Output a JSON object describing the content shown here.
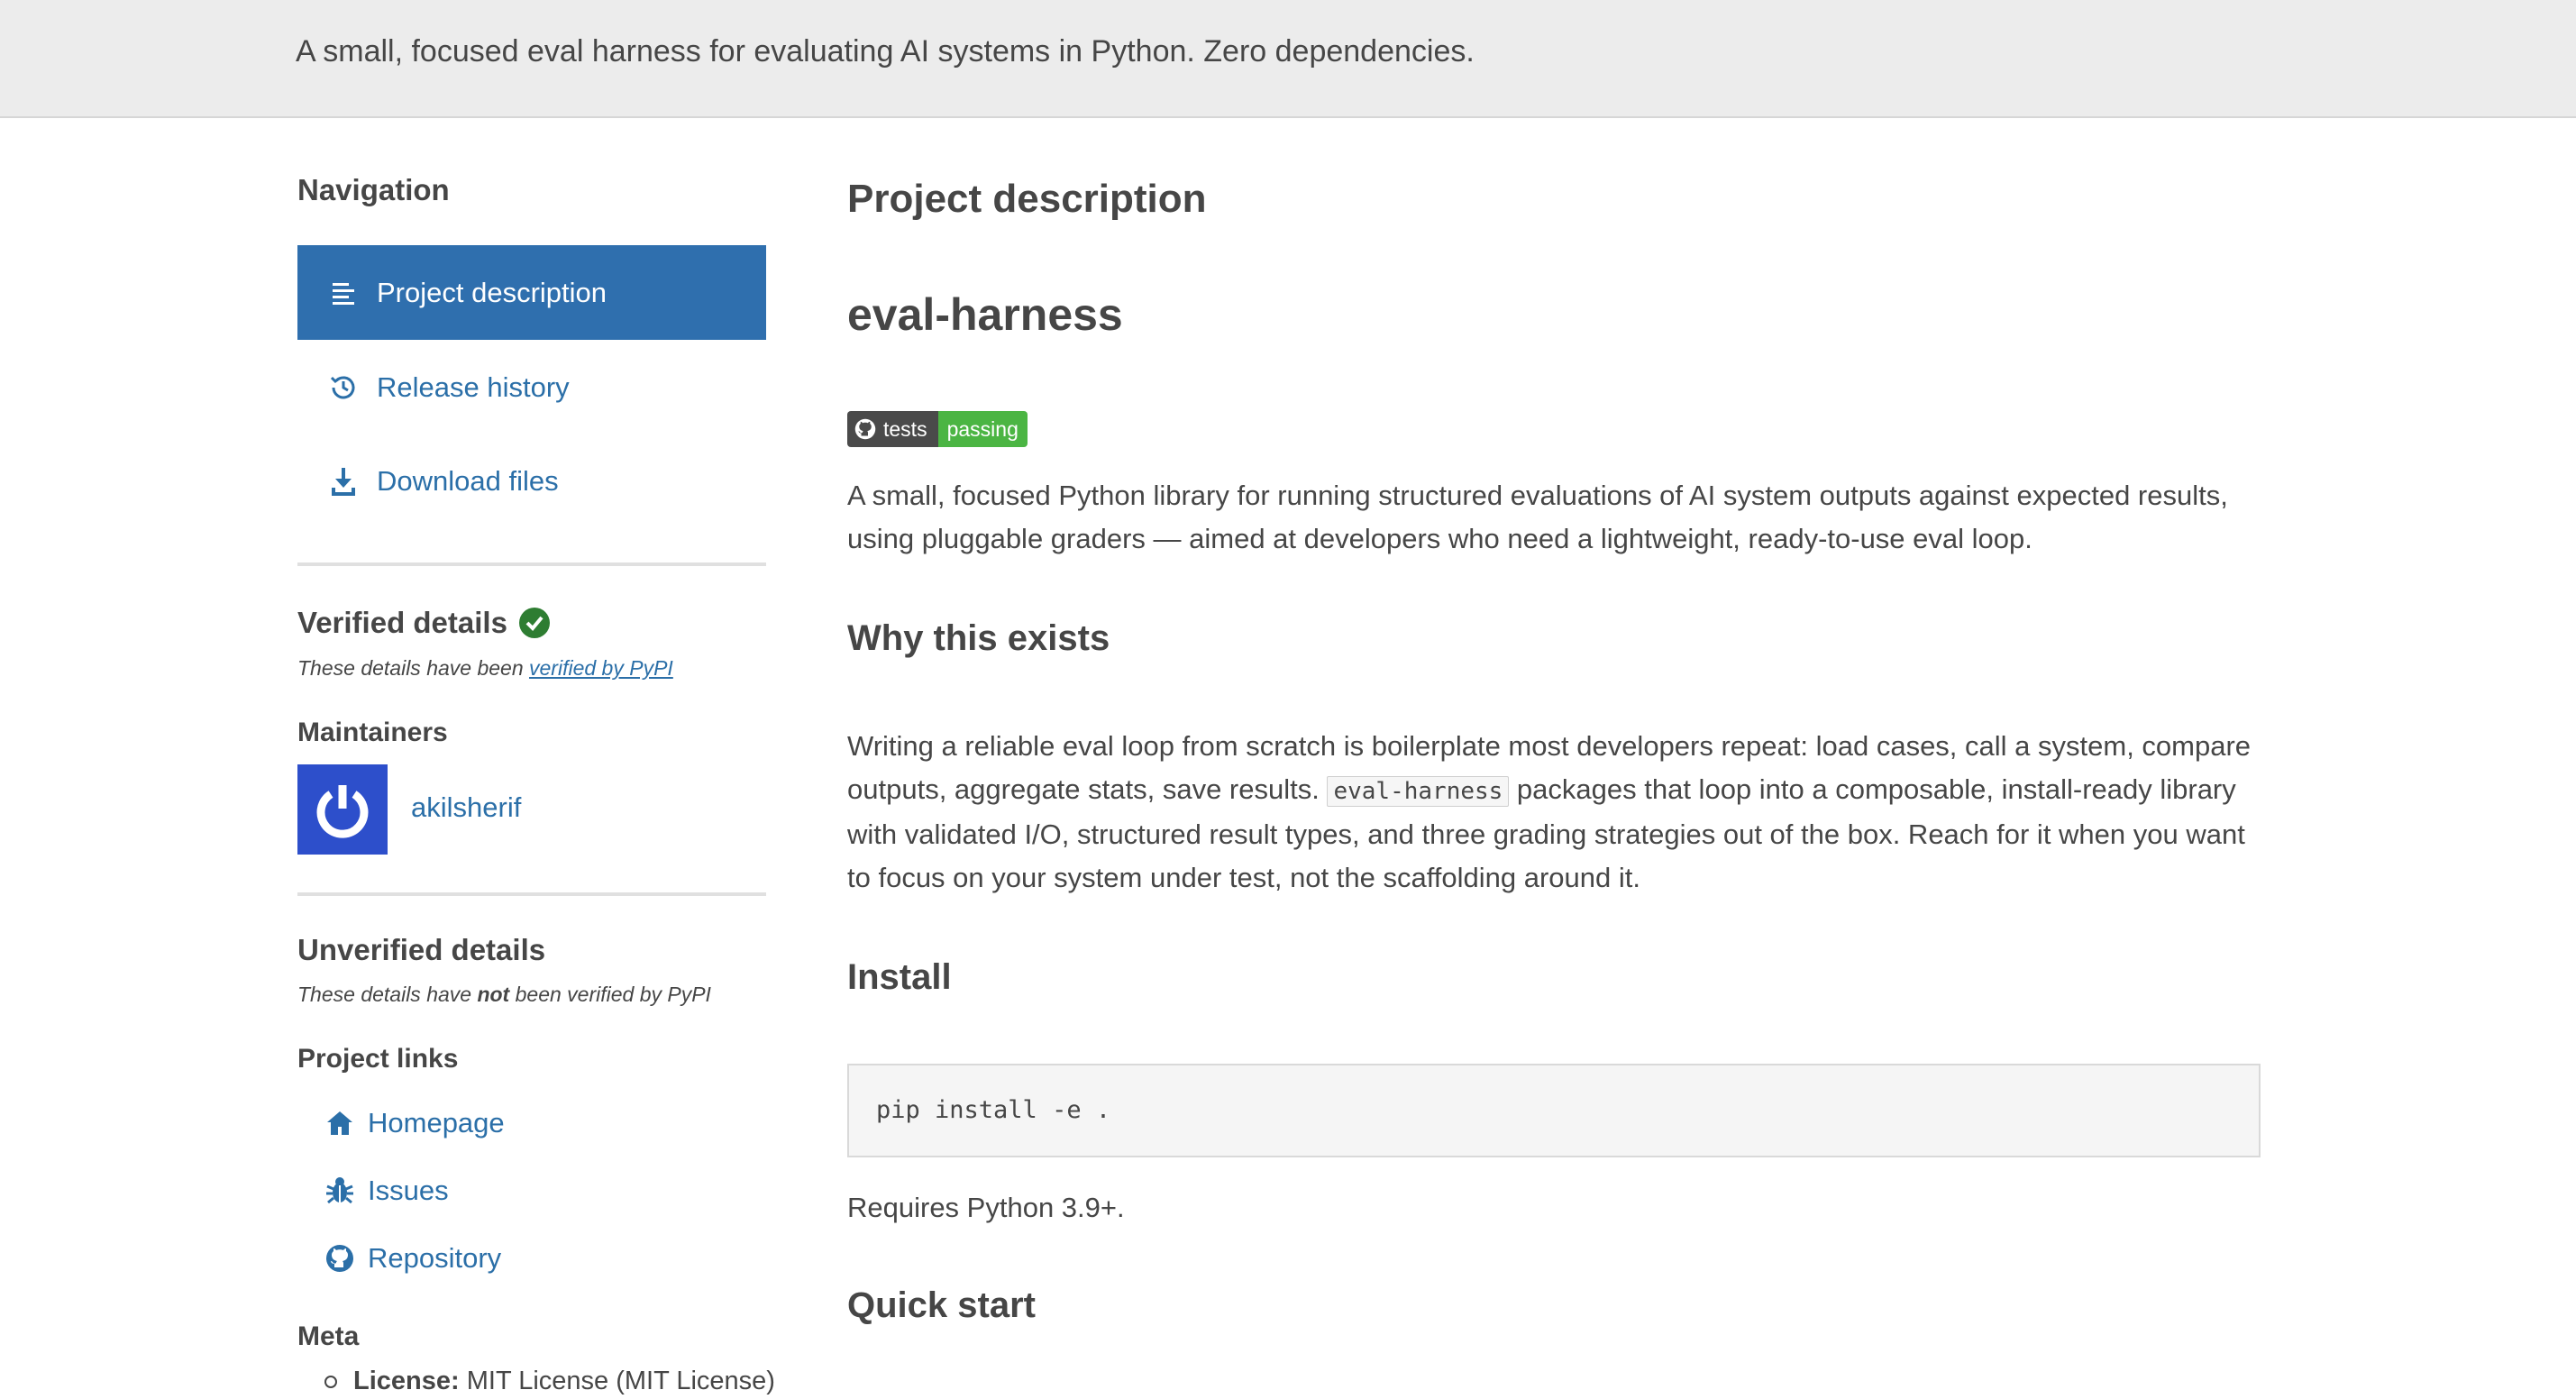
{
  "banner": {
    "summary": "A small, focused eval harness for evaluating AI systems in Python. Zero dependencies."
  },
  "sidebar": {
    "navigation_heading": "Navigation",
    "nav_items": [
      {
        "label": "Project description",
        "icon": "list-icon",
        "active": true
      },
      {
        "label": "Release history",
        "icon": "history-icon",
        "active": false
      },
      {
        "label": "Download files",
        "icon": "download-icon",
        "active": false
      }
    ],
    "verified": {
      "heading": "Verified details",
      "note_prefix": "These details have been ",
      "note_link": "verified by PyPI",
      "maintainers_heading": "Maintainers",
      "maintainer": "akilsherif"
    },
    "unverified": {
      "heading": "Unverified details",
      "note_prefix": "These details have ",
      "note_bold": "not",
      "note_suffix": " been verified by PyPI",
      "project_links_heading": "Project links",
      "links": [
        {
          "label": "Homepage",
          "icon": "home-icon"
        },
        {
          "label": "Issues",
          "icon": "bug-icon"
        },
        {
          "label": "Repository",
          "icon": "github-icon"
        }
      ],
      "meta_heading": "Meta",
      "license_label": "License:",
      "license_value": "MIT License (MIT License)"
    }
  },
  "main": {
    "section_title": "Project description",
    "package_name": "eval-harness",
    "badge": {
      "left": "tests",
      "right": "passing"
    },
    "intro": "A small, focused Python library for running structured evaluations of AI system outputs against expected results, using pluggable graders — aimed at developers who need a lightweight, ready-to-use eval loop.",
    "why_heading": "Why this exists",
    "why_text_1": "Writing a reliable eval loop from scratch is boilerplate most developers repeat: load cases, call a system, compare outputs, aggregate stats, save results. ",
    "why_code": "eval-harness",
    "why_text_2": " packages that loop into a composable, install-ready library with validated I/O, structured result types, and three grading strategies out of the box. Reach for it when you want to focus on your system under test, not the scaffolding around it.",
    "install_heading": "Install",
    "install_command": "pip install -e .",
    "requires": "Requires Python 3.9+.",
    "quickstart_heading": "Quick start"
  },
  "colors": {
    "accent": "#2f6fae",
    "link": "#2b6fa8",
    "verified": "#2e7d32",
    "badge_pass": "#4bb543"
  }
}
